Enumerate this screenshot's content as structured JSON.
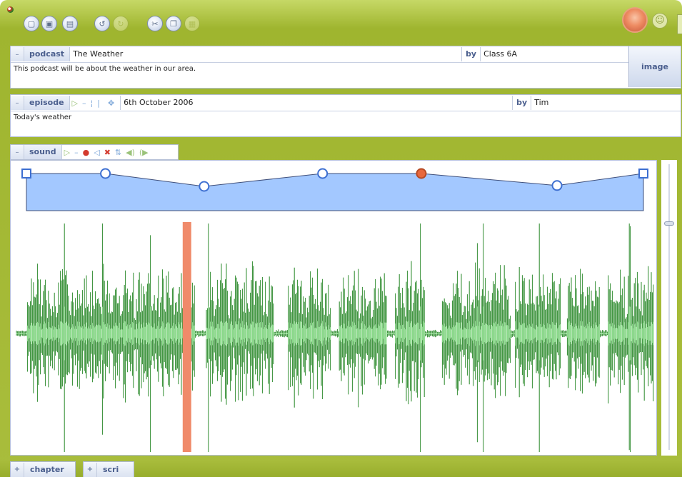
{
  "toolbar": {
    "buttons": [
      {
        "icon": "new-document-icon",
        "glyph": "▢",
        "enabled": true
      },
      {
        "icon": "open-document-icon",
        "glyph": "▣",
        "enabled": true
      },
      {
        "icon": "save-icon",
        "glyph": "▤",
        "enabled": true
      },
      {
        "icon": "undo-icon",
        "glyph": "↺",
        "enabled": true
      },
      {
        "icon": "redo-icon",
        "glyph": "↻",
        "enabled": false
      },
      {
        "icon": "cut-icon",
        "glyph": "✂",
        "enabled": true
      },
      {
        "icon": "copy-icon",
        "glyph": "❐",
        "enabled": true
      },
      {
        "icon": "paste-icon",
        "glyph": "▦",
        "enabled": false
      }
    ],
    "smiley_glyph": "☺"
  },
  "podcast": {
    "label": "podcast",
    "title": "The Weather",
    "by_label": "by",
    "author": "Class 6A",
    "description": "This podcast will be about the weather in our area.",
    "image_button": "image"
  },
  "episode": {
    "label": "episode",
    "date": "6th October 2006",
    "by_label": "by",
    "author": "Tim",
    "description": "Today's weather"
  },
  "sound": {
    "label": "sound",
    "volume_level": 0.8
  },
  "envelope": {
    "points": [
      {
        "t": 0.0,
        "level": 1.0,
        "shape": "square"
      },
      {
        "t": 0.128,
        "level": 1.0,
        "shape": "circle"
      },
      {
        "t": 0.288,
        "level": 0.7,
        "shape": "circle"
      },
      {
        "t": 0.48,
        "level": 1.0,
        "shape": "circle"
      },
      {
        "t": 0.64,
        "level": 1.0,
        "shape": "circle",
        "selected": true
      },
      {
        "t": 0.86,
        "level": 0.72,
        "shape": "circle"
      },
      {
        "t": 1.0,
        "level": 1.0,
        "shape": "square"
      }
    ]
  },
  "playhead_position": 0.273,
  "colors": {
    "waveform_dark": "#2e8b2e",
    "waveform_light": "#8fe08f",
    "envelope_fill": "#a3c8ff",
    "envelope_line": "#3f4f7a",
    "handle": "#3d6fd1",
    "handle_selected": "#e8683d",
    "playhead": "#f08a6a",
    "frame_green": "#a9bd3c"
  },
  "tabs": [
    {
      "label": "chapter"
    },
    {
      "label": "scri"
    }
  ]
}
